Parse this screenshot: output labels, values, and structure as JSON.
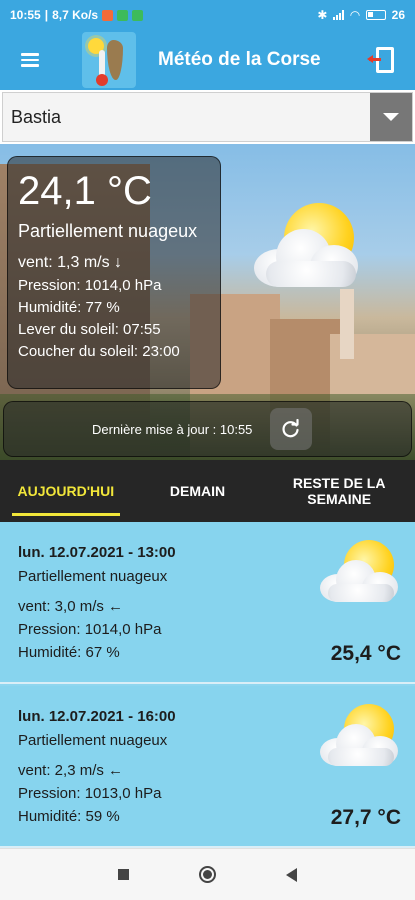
{
  "status_bar": {
    "time": "10:55",
    "network_speed": "8,7 Ko/s",
    "battery": "26"
  },
  "header": {
    "title": "Météo de la Corse"
  },
  "city": {
    "selected": "Bastia"
  },
  "current": {
    "temperature": "24,1 °C",
    "condition": "Partiellement nuageux",
    "wind": "vent: 1,3 m/s ↓",
    "pressure": "Pression: 1014,0 hPa",
    "humidity": "Humidité: 77 %",
    "sunrise": "Lever du soleil: 07:55",
    "sunset": "Coucher du soleil: 23:00",
    "weather_icon": "partly-cloudy-icon"
  },
  "update": {
    "text": "Dernière mise à jour : 10:55"
  },
  "tabs": [
    {
      "label": "AUJOURD'HUI",
      "active": true
    },
    {
      "label": "DEMAIN",
      "active": false
    },
    {
      "label": "RESTE DE LA SEMAINE",
      "active": false
    }
  ],
  "forecast": [
    {
      "datetime": "lun. 12.07.2021 - 13:00",
      "condition": "Partiellement nuageux",
      "wind": "vent: 3,0 m/s ←",
      "pressure": "Pression: 1014,0 hPa",
      "humidity": "Humidité: 67 %",
      "temperature": "25,4 °C",
      "icon": "partly-cloudy-icon"
    },
    {
      "datetime": "lun. 12.07.2021 - 16:00",
      "condition": "Partiellement nuageux",
      "wind": "vent: 2,3 m/s ←",
      "pressure": "Pression: 1013,0 hPa",
      "humidity": "Humidité: 59 %",
      "temperature": "27,7 °C",
      "icon": "partly-cloudy-icon"
    }
  ],
  "colors": {
    "primary": "#3ba7e0",
    "tab_bar": "#262626",
    "tab_active": "#f1e63a",
    "card_bg": "#87d4ee"
  }
}
